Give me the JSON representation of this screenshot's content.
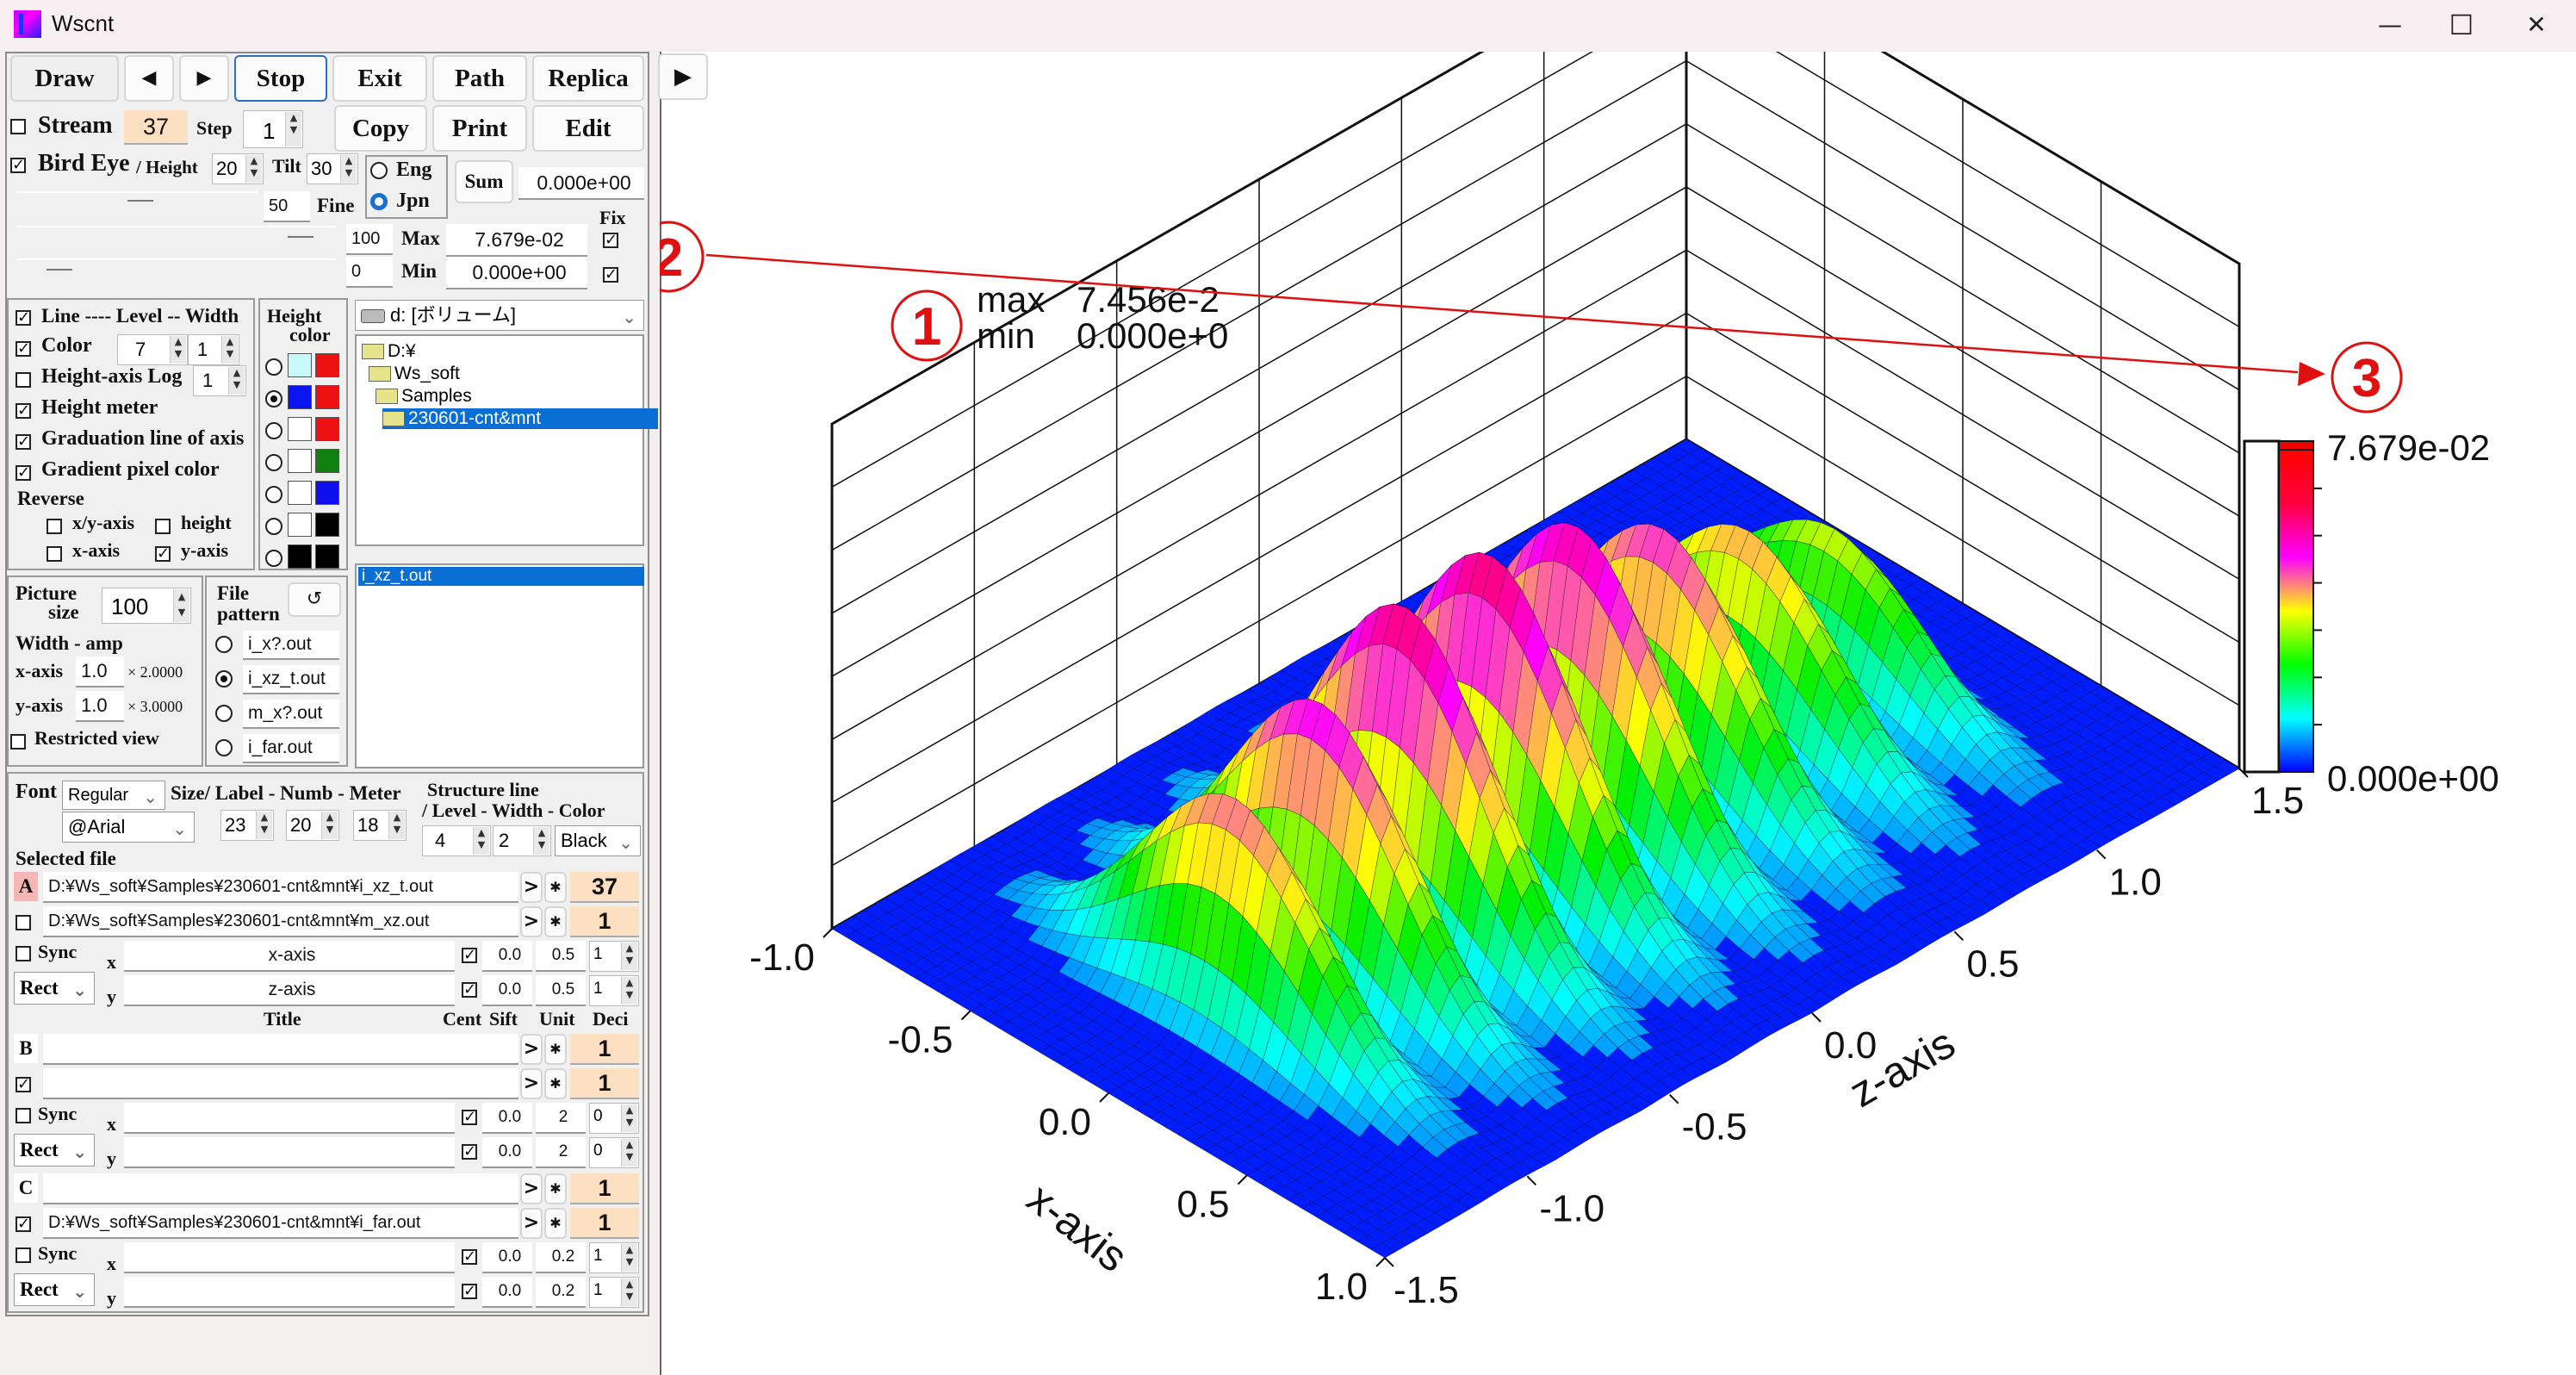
{
  "window": {
    "title": "Wscnt",
    "minimize_icon": "minimize-icon",
    "maximize_icon": "maximize-icon",
    "close_icon": "close-icon",
    "minimize_glyph": "—",
    "maximize_glyph": "☐",
    "close_glyph": "✕"
  },
  "toolbar": {
    "draw": "Draw",
    "prev": "◀",
    "next": "▶",
    "stop": "Stop",
    "exit": "Exit",
    "path": "Path",
    "replica": "Replica",
    "copy": "Copy",
    "print": "Print",
    "edit": "Edit",
    "play": "▶"
  },
  "stream": {
    "label": "Stream",
    "checked": false,
    "value": "37",
    "step_label": "Step",
    "step_value": "1"
  },
  "birdeye": {
    "label": "Bird Eye",
    "checked": true,
    "height_label": "/ Height",
    "height_value": "20",
    "tilt_label": "Tilt",
    "tilt_value": "30",
    "fine_value": "50",
    "fine_label": "Fine",
    "lang_options": [
      "Eng",
      "Jpn"
    ],
    "lang_selected": "Jpn",
    "sum_label": "Sum",
    "sum_value": "0.000e+00",
    "fix_label": "Fix",
    "max_slider": "100",
    "max_label": "Max",
    "max_value": "7.679e-02",
    "max_fix": true,
    "min_slider": "0",
    "min_label": "Min",
    "min_value": "0.000e+00",
    "min_fix": true
  },
  "options": {
    "line_label": "Line ---- Level -- Width",
    "line_checked": true,
    "color_label": "Color",
    "color_checked": true,
    "level_value": "7",
    "width_value": "1",
    "log_label": "Height-axis Log",
    "log_checked": false,
    "log_value": "1",
    "meter_label": "Height meter",
    "meter_checked": true,
    "graduation_label": "Graduation line of axis",
    "graduation_checked": true,
    "gradient_label": "Gradient pixel color",
    "gradient_checked": true,
    "reverse_label": "Reverse",
    "rev_xy_label": "x/y-axis",
    "rev_height_label": "height",
    "rev_x_label": "x-axis",
    "rev_y_label": "y-axis",
    "rev_xy": false,
    "rev_height": false,
    "rev_x": false,
    "rev_y": true
  },
  "height_color": {
    "title1": "Height",
    "title2": "color",
    "selected_index": 1,
    "pairs": [
      [
        "#c8f8f8",
        "#ee1111"
      ],
      [
        "#0a14f0",
        "#ee1111"
      ],
      [
        "#ffffff",
        "#ee1111"
      ],
      [
        "#ffffff",
        "#108010"
      ],
      [
        "#ffffff",
        "#1010ee"
      ],
      [
        "#ffffff",
        "#000000"
      ],
      [
        "#000000",
        "#000000"
      ]
    ]
  },
  "drive": {
    "value": "d: [ボリューム]"
  },
  "folders": [
    {
      "name": "D:¥",
      "selected": false
    },
    {
      "name": "Ws_soft",
      "selected": false
    },
    {
      "name": "Samples",
      "selected": false
    },
    {
      "name": "230601-cnt&mnt",
      "selected": true
    }
  ],
  "files": [
    {
      "name": "i_xz_t.out",
      "selected": true
    }
  ],
  "picture": {
    "size_label1": "Picture",
    "size_label2": "size",
    "size_value": "100",
    "width_amp_label": "Width - amp",
    "x_label": "x-axis",
    "x_value": "1.0",
    "x_mult": "× 2.0000",
    "y_label": "y-axis",
    "y_value": "1.0",
    "y_mult": "× 3.0000",
    "restricted_label": "Restricted view",
    "restricted_checked": false
  },
  "file_pattern": {
    "label1": "File",
    "label2": "pattern",
    "refresh_glyph": "↺",
    "options": [
      "i_x?.out",
      "i_xz_t.out",
      "m_x?.out",
      "i_far.out"
    ],
    "selected_index": 1
  },
  "font": {
    "label": "Font",
    "style": "Regular",
    "family": "@Arial",
    "size_label": "Size/ Label - Numb - Meter",
    "label_size": "23",
    "numb_size": "20",
    "meter_size": "18",
    "structure_label1": "Structure line",
    "structure_label2": "/ Level - Width - Color",
    "structure_level": "4",
    "structure_width": "2",
    "structure_color": "Black"
  },
  "selected_file": {
    "label": "Selected file",
    "headers": {
      "title": "Title",
      "cent": "Cent",
      "sift": "Sift",
      "unit": "Unit",
      "deci": "Deci"
    },
    "groups": [
      {
        "tag": "A",
        "primary_path": "D:¥Ws_soft¥Samples¥230601-cnt&mnt¥i_xz_t.out",
        "primary_count": "37",
        "secondary_checked": false,
        "secondary_path": "D:¥Ws_soft¥Samples¥230601-cnt&mnt¥m_xz.out",
        "secondary_count": "1",
        "sync_checked": false,
        "sync_label": "Sync",
        "shape": "Rect",
        "x_title": "x-axis",
        "x_cent": true,
        "x_sift": "0.0",
        "x_unit": "0.5",
        "x_deci": "1",
        "y_title": "z-axis",
        "y_cent": true,
        "y_sift": "0.0",
        "y_unit": "0.5",
        "y_deci": "1"
      },
      {
        "tag": "B",
        "primary_path": "",
        "primary_count": "1",
        "secondary_checked": true,
        "secondary_path": "",
        "secondary_count": "1",
        "sync_checked": false,
        "sync_label": "Sync",
        "shape": "Rect",
        "x_title": "",
        "x_cent": true,
        "x_sift": "0.0",
        "x_unit": "2",
        "x_deci": "0",
        "y_title": "",
        "y_cent": true,
        "y_sift": "0.0",
        "y_unit": "2",
        "y_deci": "0"
      },
      {
        "tag": "C",
        "primary_path": "",
        "primary_count": "1",
        "secondary_checked": true,
        "secondary_path": "D:¥Ws_soft¥Samples¥230601-cnt&mnt¥i_far.out",
        "secondary_count": "1",
        "sync_checked": false,
        "sync_label": "Sync",
        "shape": "Rect",
        "x_title": "",
        "x_cent": true,
        "x_sift": "0.0",
        "x_unit": "0.2",
        "x_deci": "1",
        "y_title": "",
        "y_cent": true,
        "y_sift": "0.0",
        "y_unit": "0.2",
        "y_deci": "1"
      }
    ],
    "arrow_glyph": ">",
    "star_glyph": "✱",
    "x_letter": "x",
    "y_letter": "y"
  },
  "annotations": {
    "marker1": "①",
    "marker2": "②",
    "marker3": "③",
    "color": "#e01010"
  },
  "chart_data": {
    "type": "surface3d",
    "title": "",
    "stats": {
      "max_label": "max",
      "max_value": "7.456e-2",
      "min_label": "min",
      "min_value": "0.000e+0"
    },
    "x_axis": {
      "label": "x-axis",
      "range": [
        -1.0,
        1.0
      ],
      "ticks": [
        "-1.0",
        "-0.5",
        "0.0",
        "0.5",
        "1.0"
      ]
    },
    "z_axis": {
      "label": "z-axis",
      "range": [
        -1.5,
        1.5
      ],
      "ticks": [
        "-1.5",
        "-1.0",
        "-0.5",
        "0.0",
        "0.5",
        "1.0",
        "1.5"
      ]
    },
    "height_range": [
      0.0,
      0.07679
    ],
    "colorbar": {
      "max_label": "7.679e-02",
      "min_label": "0.000e+00",
      "colors": [
        "#0000ff",
        "#00ffff",
        "#00ff00",
        "#ffff00",
        "#ff00ff",
        "#ff0040",
        "#ff0000"
      ]
    },
    "grid": true,
    "ridges": [
      {
        "z": -1.05,
        "peak": 0.052
      },
      {
        "z": -0.75,
        "peak": 0.063
      },
      {
        "z": -0.45,
        "peak": 0.074
      },
      {
        "z": -0.15,
        "peak": 0.0746
      },
      {
        "z": 0.15,
        "peak": 0.07
      },
      {
        "z": 0.45,
        "peak": 0.058
      },
      {
        "z": 0.75,
        "peak": 0.046
      },
      {
        "z": 1.05,
        "peak": 0.035
      }
    ],
    "ridge_width_x": 0.45,
    "ridge_width_z": 0.11
  }
}
